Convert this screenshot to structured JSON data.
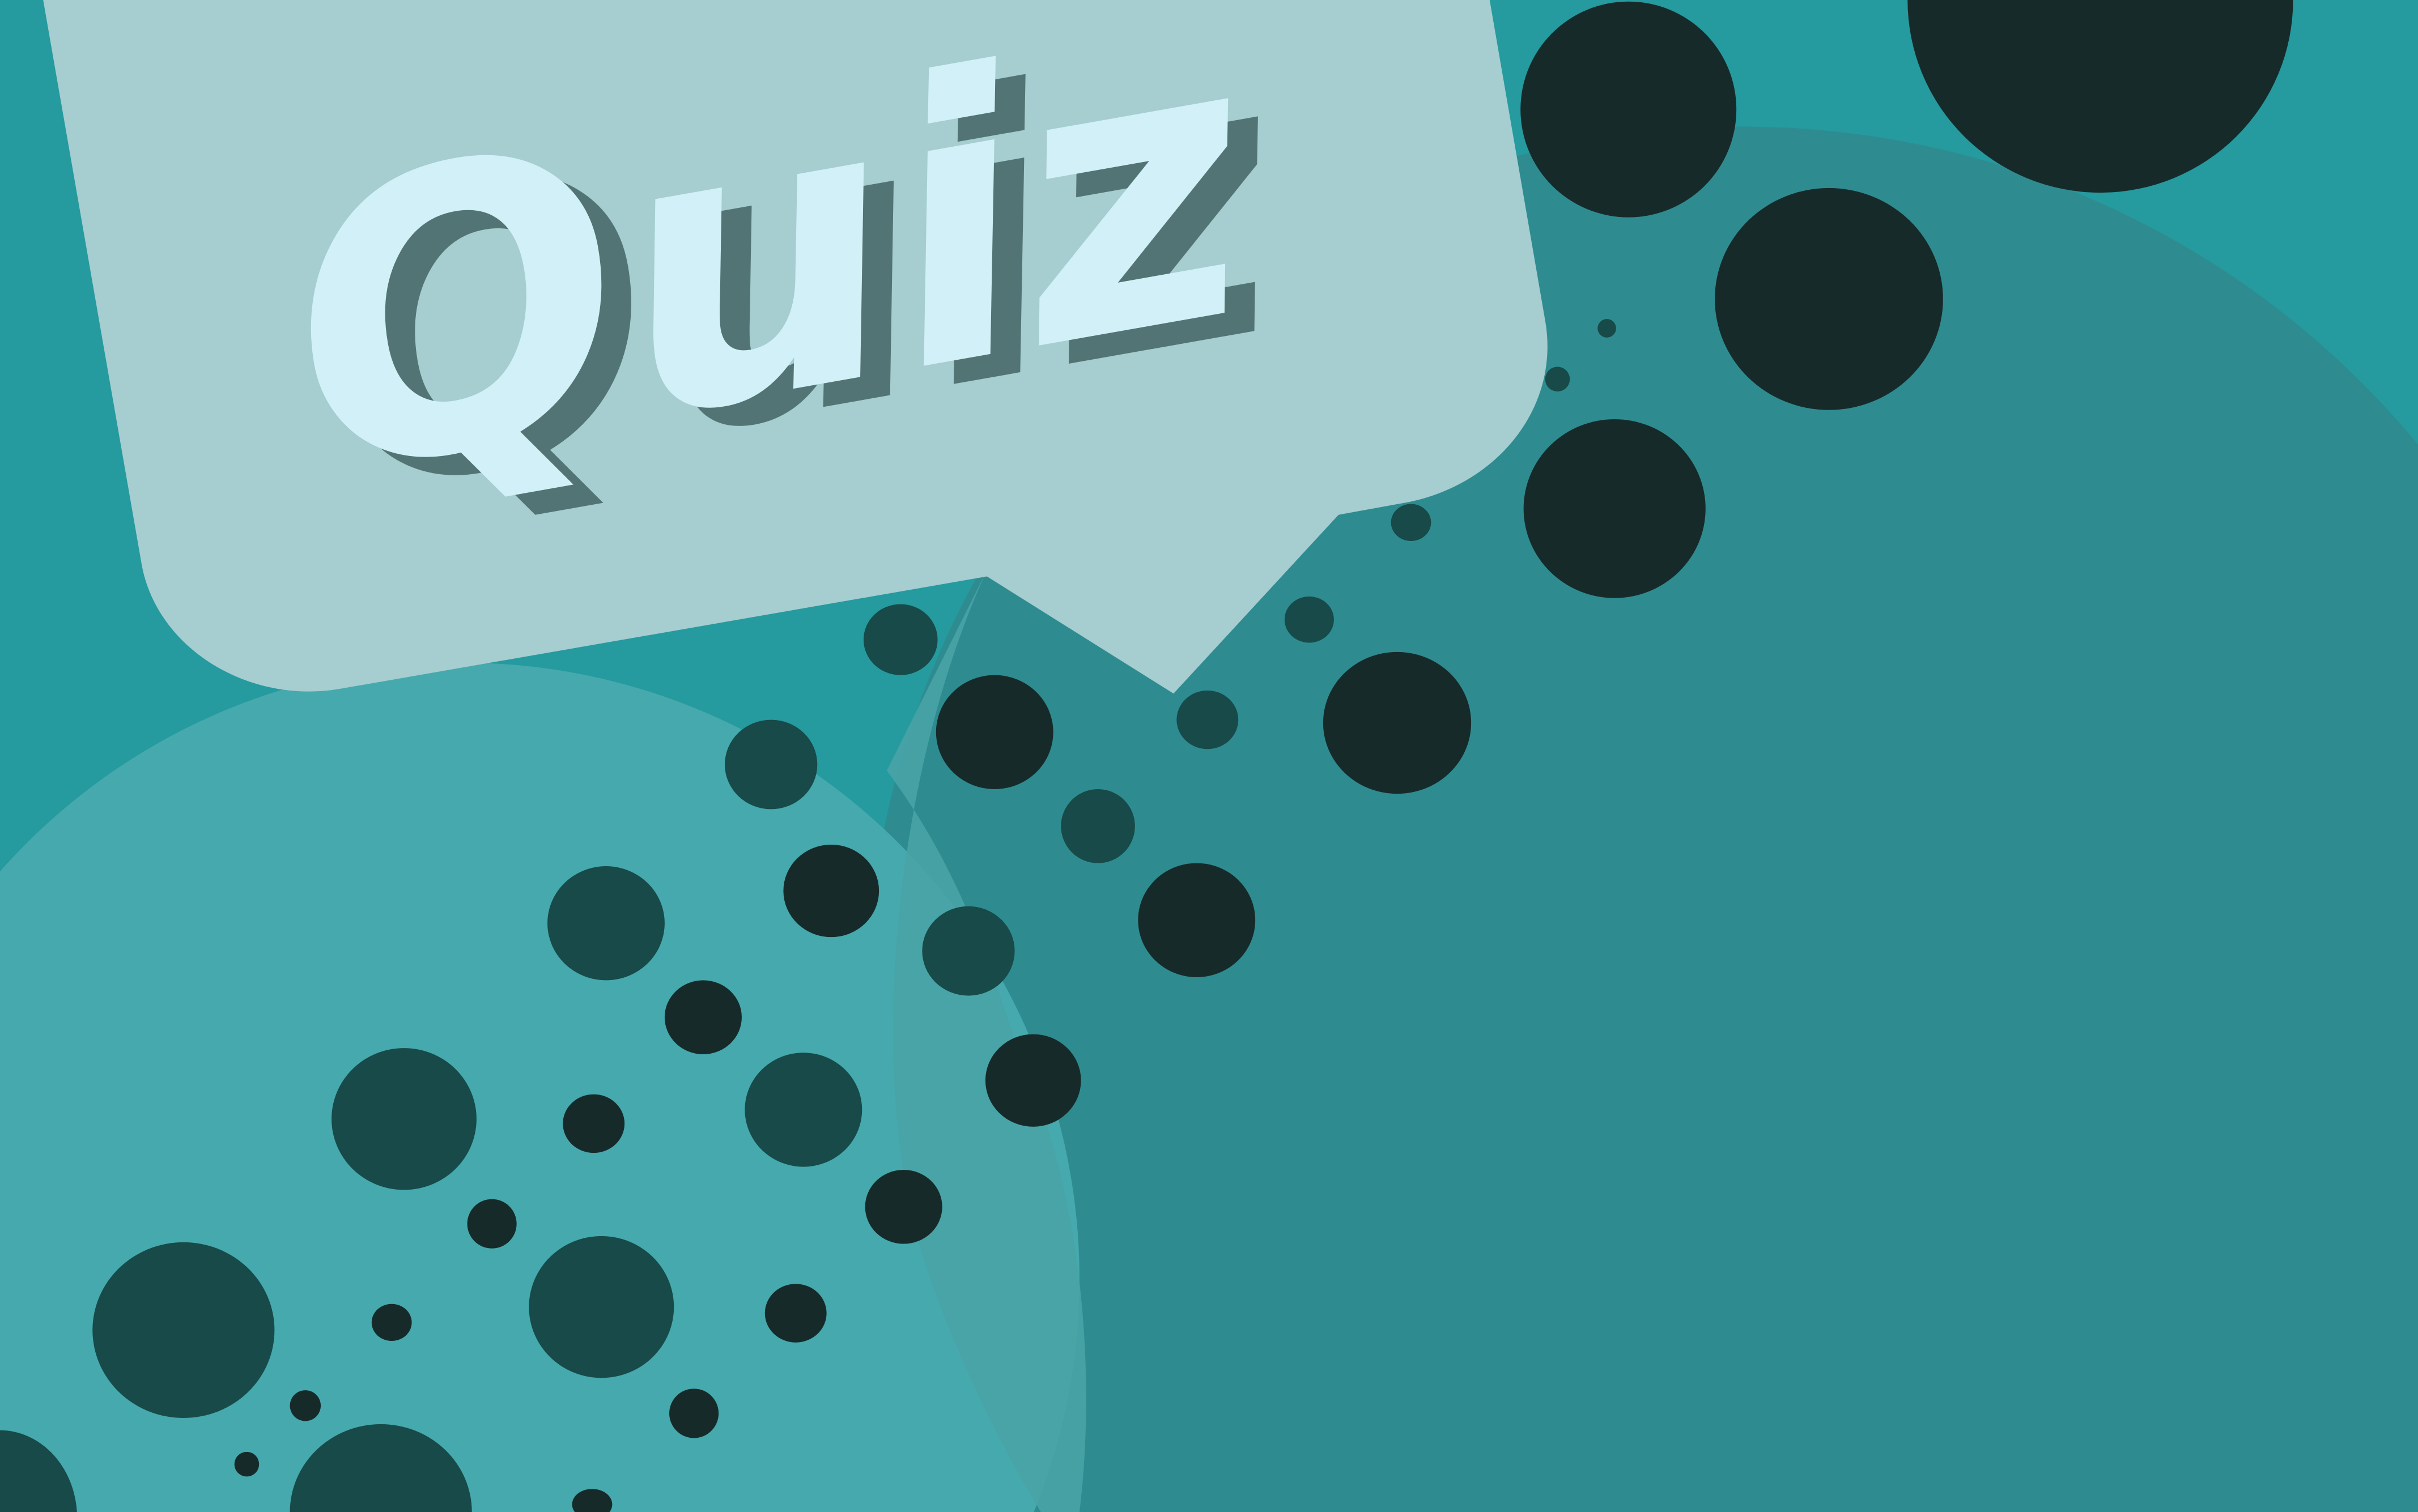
{
  "title": {
    "text": "Quiz"
  },
  "colors": {
    "background": "#259a9f",
    "right_blob": "#2e8c90",
    "left_blob": "#45a9ad",
    "bubble": "#a6cdcf",
    "title_fill": "#d2f0f8",
    "title_shadow": "#527474",
    "dark_dot": "#172a2a",
    "mid_dot": "#174a48"
  }
}
